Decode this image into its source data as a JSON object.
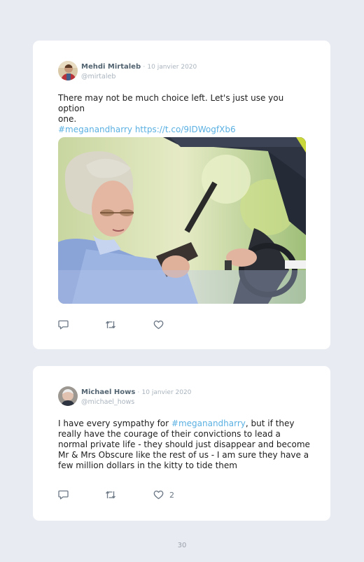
{
  "tweets": [
    {
      "author_name": "Mehdi Mirtaleb",
      "separator": "·",
      "date": "10 janvier 2020",
      "handle": "@mirtaleb",
      "text_line1": "There may not be much choice left. Let's just use you option",
      "text_line2": "one.",
      "hashtag": "#meganandharry",
      "url": "https://t.co/9IDWogfXb6",
      "image_description": "Photo of an elderly woman driving a car while holding a pistol",
      "like_count": ""
    },
    {
      "author_name": "Michael Hows",
      "separator": "·",
      "date": "10 janvier 2020",
      "handle": "@michael_hows",
      "text_prefix": "I have every sympathy for ",
      "hashtag": "#meganandharry",
      "text_suffix": ", but if they really have the courage of their convictions to lead a normal private life - they should just disappear and become Mr & Mrs Obscure like the rest of us - I am sure they have a few million dollars in the kitty to tide them",
      "like_count": "2"
    }
  ],
  "page_number": "30",
  "colors": {
    "background": "#e9ebf2",
    "card": "#ffffff",
    "link": "#5ab0e2",
    "name": "#536471",
    "muted": "#aab4be"
  },
  "icons": [
    "reply-icon",
    "retweet-icon",
    "like-icon"
  ]
}
